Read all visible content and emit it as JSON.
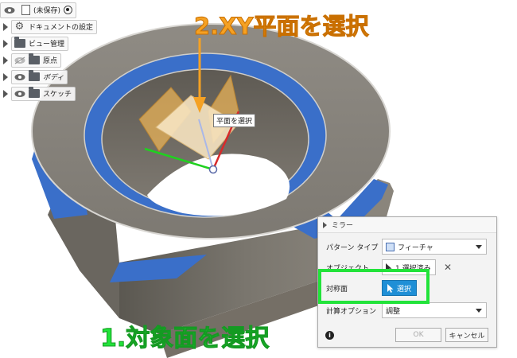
{
  "browser": {
    "root_label": "(未保存)",
    "items": [
      {
        "label": "ドキュメントの設定",
        "icon": "gear-icon"
      },
      {
        "label": "ビュー管理",
        "icon": "folder-icon"
      },
      {
        "label": "原点",
        "icon": "folder-icon"
      },
      {
        "label": "ボディ",
        "icon": "folder-icon"
      },
      {
        "label": "スケッチ",
        "icon": "folder-icon"
      }
    ]
  },
  "annotations": {
    "step2": "2.XY平面を選択",
    "step1": "1.対象面を選択",
    "plane_tooltip": "平面を選択"
  },
  "dialog": {
    "title": "ミラー",
    "pattern_type_label": "パターン タイプ",
    "pattern_type_value": "フィーチャ",
    "objects_label": "オブジェクト",
    "objects_value": "1 選択済み",
    "symmetry_plane_label": "対称面",
    "select_button": "選択",
    "compute_option_label": "計算オプション",
    "compute_option_value": "調整",
    "ok": "OK",
    "cancel": "キャンセル"
  },
  "colors": {
    "annotation_orange": "#f5a123",
    "annotation_green": "#22e33a",
    "select_blue": "#1f8fd6",
    "face_blue": "#3a6fc9"
  }
}
